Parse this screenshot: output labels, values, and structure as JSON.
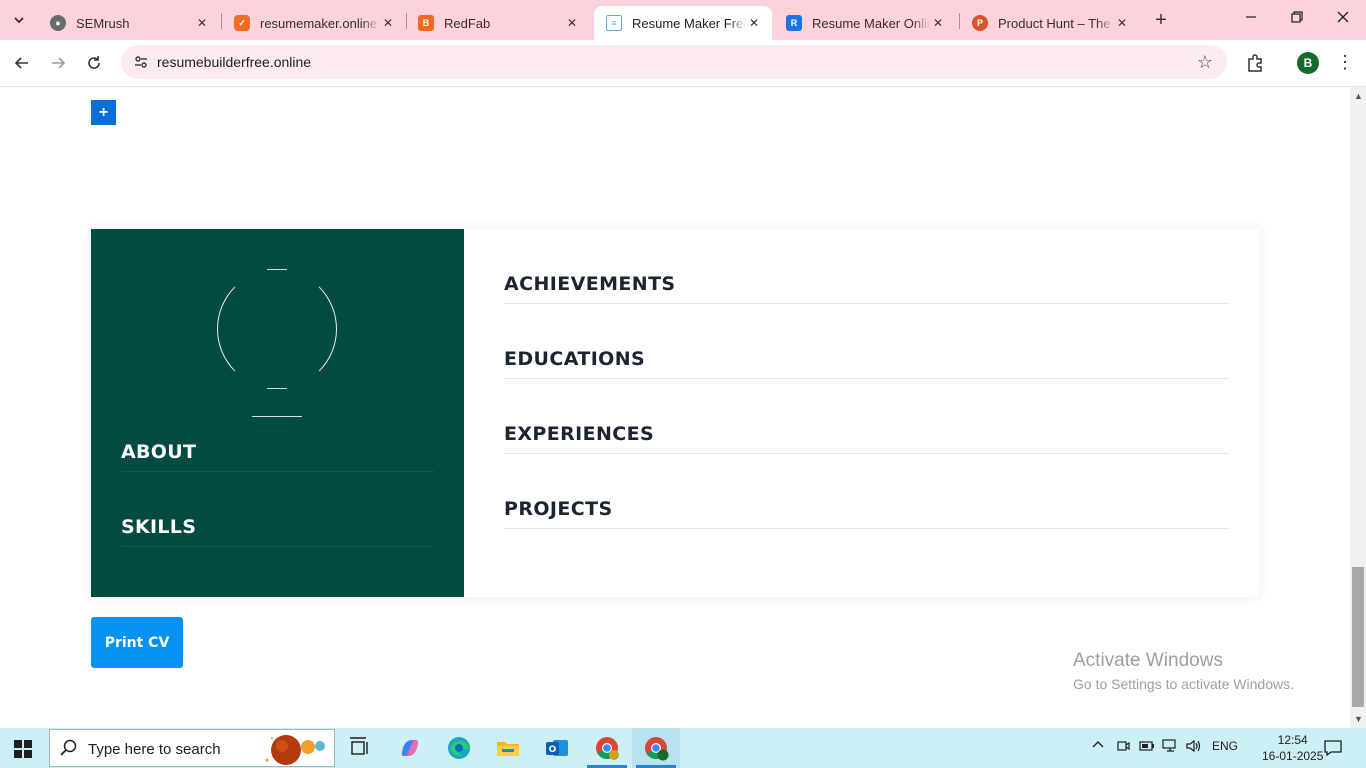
{
  "browser": {
    "tabs": [
      {
        "title": "SEMrush",
        "favicon": "semrush-icon",
        "favicon_color": "#555555"
      },
      {
        "title": "resumemaker.online:",
        "favicon": "resumemaker-icon",
        "favicon_color": "#f36c21"
      },
      {
        "title": "RedFab",
        "favicon": "blogger-icon",
        "favicon_color": "#f26a20"
      },
      {
        "title": "Resume Maker Free",
        "favicon": "document-icon",
        "favicon_color": "#6aa7d8",
        "active": true
      },
      {
        "title": "Resume Maker Online",
        "favicon": "resume-app-icon",
        "favicon_color": "#1a73e8"
      },
      {
        "title": "Product Hunt – The b",
        "favicon": "producthunt-icon",
        "favicon_color": "#da552f"
      }
    ],
    "url": "resumebuilderfree.online",
    "profile_initial": "B",
    "colors": {
      "tabbar": "#fcd2db",
      "omnibox": "#fcecf0"
    }
  },
  "page": {
    "add_label": "+",
    "sidebar": {
      "about_heading": "ABOUT",
      "skills_heading": "SKILLS",
      "color": "#034a40"
    },
    "main": {
      "achievements_heading": "ACHIEVEMENTS",
      "educations_heading": "EDUCATIONS",
      "experiences_heading": "EXPERIENCES",
      "projects_heading": "PROJECTS"
    },
    "print_label": "Print CV",
    "print_color": "#0592f0"
  },
  "watermark": {
    "line1": "Activate Windows",
    "line2": "Go to Settings to activate Windows."
  },
  "taskbar": {
    "search_placeholder": "Type here to search",
    "language": "ENG",
    "time": "12:54",
    "date": "16-01-2025"
  }
}
